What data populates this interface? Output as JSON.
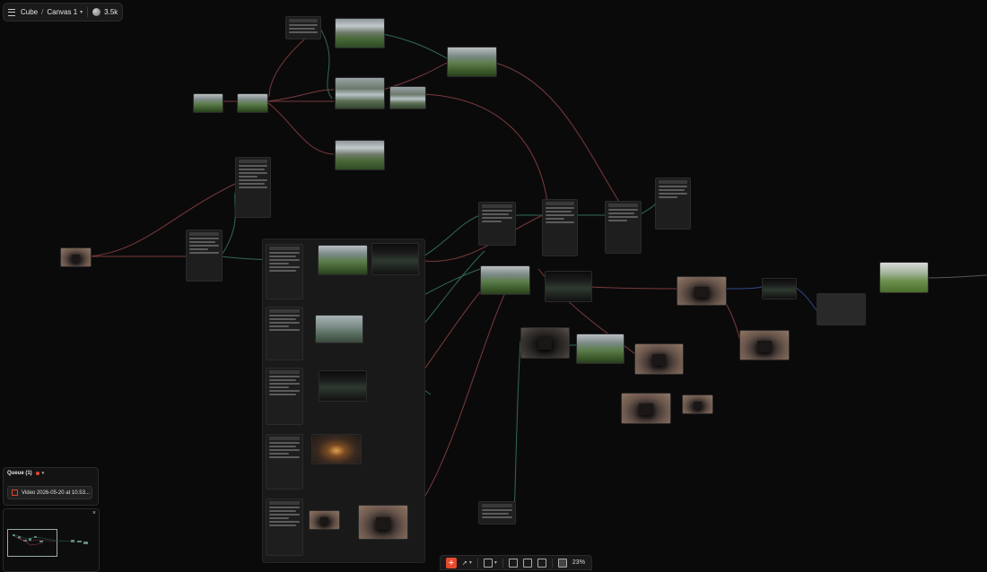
{
  "breadcrumb": {
    "menu_icon": "menu-icon",
    "project": "Cube",
    "separator": "/",
    "canvas": "Canvas 1",
    "dropdown_icon": "chevron-down-icon"
  },
  "user": {
    "count": "3.5k"
  },
  "queue": {
    "title": "Queue (1)",
    "status_color": "#e8452c",
    "item_label": "Video 2026-05-20 at 10.53..."
  },
  "minimap": {
    "close": "×"
  },
  "toolbar": {
    "add": "+",
    "zoom": "23%",
    "accent": "#e84a2e"
  }
}
